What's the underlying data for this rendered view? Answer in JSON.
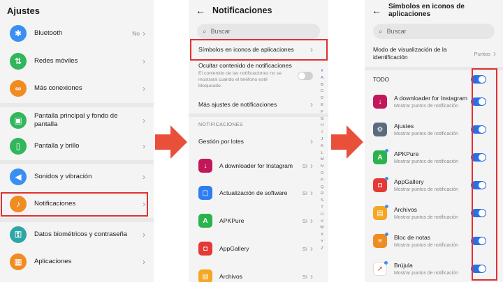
{
  "panel1": {
    "title": "Ajustes",
    "items": [
      {
        "label": "Bluetooth",
        "value": "No",
        "icon": "bluetooth-icon",
        "glyph": "✱",
        "color": "#3a8ff2"
      },
      {
        "label": "Redes móviles",
        "value": "",
        "icon": "signal-icon",
        "glyph": "⇅",
        "color": "#31b65b"
      },
      {
        "label": "Más conexiones",
        "value": "",
        "icon": "link-icon",
        "glyph": "∞",
        "color": "#f08c21"
      },
      {
        "label": "Pantalla principal y fondo de pantalla",
        "value": "",
        "icon": "image-icon",
        "glyph": "▣",
        "color": "#31b65b"
      },
      {
        "label": "Pantalla y brillo",
        "value": "",
        "icon": "phone-icon",
        "glyph": "▯",
        "color": "#31b65b"
      },
      {
        "label": "Sonidos y vibración",
        "value": "",
        "icon": "speaker-icon",
        "glyph": "◀",
        "color": "#3a8ff2"
      },
      {
        "label": "Notificaciones",
        "value": "",
        "icon": "bell-icon",
        "glyph": "♪",
        "color": "#f08c21"
      },
      {
        "label": "Datos biométricos y contraseña",
        "value": "",
        "icon": "key-icon",
        "glyph": "⚿",
        "color": "#2ea6a6"
      },
      {
        "label": "Aplicaciones",
        "value": "",
        "icon": "apps-icon",
        "glyph": "▦",
        "color": "#f08c21"
      }
    ]
  },
  "panel2": {
    "title": "Notificaciones",
    "search_placeholder": "Buscar",
    "badge_icons": "Símbolos en iconos de aplicaciones",
    "hide_content": "Ocultar contenido de notificaciones",
    "hide_content_hint": "El contenido de las notificaciones no se mostrará cuando el teléfono esté bloqueado.",
    "more_settings": "Más ajustes de notificaciones",
    "section": "NOTIFICACIONES",
    "batch": "Gestión por lotes",
    "apps": [
      {
        "name": "A downloader for Instagram",
        "value": "Sí",
        "icon": "downloader-icon",
        "glyph": "↓",
        "color": "#c2185b"
      },
      {
        "name": "Actualización de software",
        "value": "Sí",
        "icon": "update-icon",
        "glyph": "▢",
        "color": "#2f7df0"
      },
      {
        "name": "APKPure",
        "value": "Sí",
        "icon": "apkpure-icon",
        "glyph": "A",
        "color": "#2bb24c"
      },
      {
        "name": "AppGallery",
        "value": "Sí",
        "icon": "appgallery-icon",
        "glyph": "◘",
        "color": "#e53935"
      },
      {
        "name": "Archivos",
        "value": "Sí",
        "icon": "folder-icon",
        "glyph": "▤",
        "color": "#f5a623"
      }
    ],
    "alphabet": [
      "#",
      "A",
      "B",
      "C",
      "D",
      "E",
      "F",
      "G",
      "H",
      "I",
      "J",
      "K",
      "L",
      "M",
      "N",
      "O",
      "P",
      "Q",
      "R",
      "S",
      "T",
      "U",
      "V",
      "W",
      "X",
      "Y",
      "Z"
    ]
  },
  "panel3": {
    "title": "Símbolos en iconos de aplicaciones",
    "search_placeholder": "Buscar",
    "mode_label": "Modo de visualización de la identificación",
    "mode_value": "Puntos",
    "all_label": "TODO",
    "apps": [
      {
        "name": "A downloader for Instagram",
        "sub": "Mostrar puntos de notificación",
        "icon": "downloader-icon",
        "glyph": "↓",
        "color": "#c2185b"
      },
      {
        "name": "Ajustes",
        "sub": "Mostrar puntos de notificación",
        "icon": "gear-icon",
        "glyph": "⚙",
        "color": "#5a6b80"
      },
      {
        "name": "APKPure",
        "sub": "Mostrar puntos de notificación",
        "icon": "apkpure-icon",
        "glyph": "A",
        "color": "#2bb24c"
      },
      {
        "name": "AppGallery",
        "sub": "Mostrar puntos de notificación",
        "icon": "appgallery-icon",
        "glyph": "◘",
        "color": "#e53935"
      },
      {
        "name": "Archivos",
        "sub": "Mostrar puntos de notificación",
        "icon": "folder-icon",
        "glyph": "▤",
        "color": "#f5a623"
      },
      {
        "name": "Bloc de notas",
        "sub": "Mostrar puntos de notificación",
        "icon": "notepad-icon",
        "glyph": "≡",
        "color": "#f08c21"
      },
      {
        "name": "Brújula",
        "sub": "Mostrar puntos de notificación",
        "icon": "compass-icon",
        "glyph": "➚",
        "color": "#e53935"
      }
    ]
  },
  "accent": "#2a6fe6",
  "highlight": "#e03131",
  "arrow_color": "#e8503a"
}
